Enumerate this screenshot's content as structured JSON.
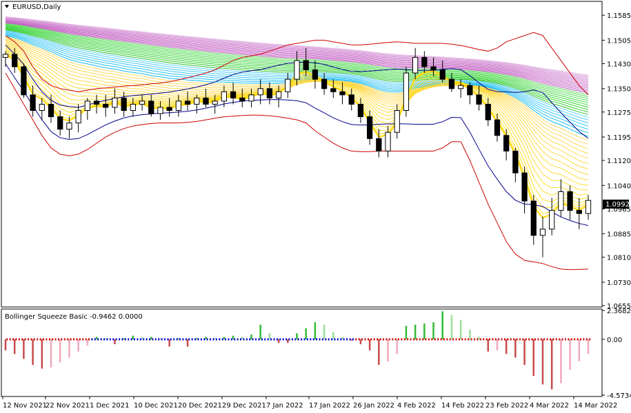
{
  "chart_data": [
    {
      "type": "candlestick",
      "title": "EURUSD,Daily",
      "yticks": [
        "1.1585",
        "1.1505",
        "1.1430",
        "1.1350",
        "1.1275",
        "1.1195",
        "1.1120",
        "1.1040",
        "1.0965",
        "1.0885",
        "1.0810",
        "1.0730",
        "1.0655"
      ],
      "ylim": [
        1.0655,
        1.1625
      ],
      "current_price": "1.0992",
      "colors": {
        "up": "#ffffff",
        "down": "#000000",
        "bb_outer": "#cc0000",
        "bb_inner": "#00008b",
        "ribbon_fast": "#ffd700",
        "ribbon_mid": "#00aaff",
        "ribbon_green": "#22cc22",
        "ribbon_slow": "#9944aa"
      },
      "candles": [
        [
          1.145,
          1.147,
          1.142,
          1.146
        ],
        [
          1.146,
          1.148,
          1.14,
          1.142
        ],
        [
          1.142,
          1.143,
          1.132,
          1.133
        ],
        [
          1.133,
          1.136,
          1.126,
          1.128
        ],
        [
          1.128,
          1.132,
          1.125,
          1.13
        ],
        [
          1.13,
          1.133,
          1.124,
          1.126
        ],
        [
          1.126,
          1.128,
          1.12,
          1.122
        ],
        [
          1.122,
          1.126,
          1.119,
          1.124
        ],
        [
          1.124,
          1.13,
          1.121,
          1.128
        ],
        [
          1.128,
          1.132,
          1.125,
          1.131
        ],
        [
          1.131,
          1.133,
          1.127,
          1.13
        ],
        [
          1.13,
          1.133,
          1.126,
          1.129
        ],
        [
          1.129,
          1.135,
          1.127,
          1.132
        ],
        [
          1.132,
          1.134,
          1.126,
          1.128
        ],
        [
          1.128,
          1.132,
          1.126,
          1.13
        ],
        [
          1.13,
          1.133,
          1.128,
          1.131
        ],
        [
          1.131,
          1.133,
          1.126,
          1.127
        ],
        [
          1.127,
          1.131,
          1.125,
          1.129
        ],
        [
          1.129,
          1.132,
          1.126,
          1.128
        ],
        [
          1.128,
          1.133,
          1.126,
          1.131
        ],
        [
          1.131,
          1.134,
          1.128,
          1.13
        ],
        [
          1.13,
          1.133,
          1.127,
          1.132
        ],
        [
          1.132,
          1.135,
          1.129,
          1.13
        ],
        [
          1.13,
          1.133,
          1.127,
          1.131
        ],
        [
          1.131,
          1.136,
          1.129,
          1.134
        ],
        [
          1.134,
          1.137,
          1.13,
          1.132
        ],
        [
          1.132,
          1.135,
          1.129,
          1.131
        ],
        [
          1.131,
          1.135,
          1.129,
          1.133
        ],
        [
          1.133,
          1.138,
          1.13,
          1.135
        ],
        [
          1.135,
          1.137,
          1.13,
          1.132
        ],
        [
          1.132,
          1.136,
          1.129,
          1.134
        ],
        [
          1.134,
          1.14,
          1.132,
          1.138
        ],
        [
          1.138,
          1.147,
          1.136,
          1.144
        ],
        [
          1.144,
          1.148,
          1.139,
          1.141
        ],
        [
          1.141,
          1.144,
          1.135,
          1.138
        ],
        [
          1.138,
          1.14,
          1.133,
          1.135
        ],
        [
          1.135,
          1.138,
          1.132,
          1.134
        ],
        [
          1.134,
          1.137,
          1.13,
          1.133
        ],
        [
          1.133,
          1.135,
          1.128,
          1.13
        ],
        [
          1.13,
          1.132,
          1.124,
          1.126
        ],
        [
          1.126,
          1.128,
          1.117,
          1.119
        ],
        [
          1.119,
          1.122,
          1.113,
          1.115
        ],
        [
          1.115,
          1.123,
          1.113,
          1.121
        ],
        [
          1.121,
          1.13,
          1.119,
          1.128
        ],
        [
          1.128,
          1.142,
          1.126,
          1.14
        ],
        [
          1.14,
          1.148,
          1.138,
          1.145
        ],
        [
          1.145,
          1.147,
          1.14,
          1.142
        ],
        [
          1.142,
          1.145,
          1.139,
          1.141
        ],
        [
          1.141,
          1.144,
          1.137,
          1.138
        ],
        [
          1.138,
          1.14,
          1.134,
          1.135
        ],
        [
          1.135,
          1.138,
          1.132,
          1.136
        ],
        [
          1.136,
          1.137,
          1.13,
          1.133
        ],
        [
          1.133,
          1.136,
          1.128,
          1.13
        ],
        [
          1.13,
          1.132,
          1.123,
          1.125
        ],
        [
          1.125,
          1.127,
          1.118,
          1.12
        ],
        [
          1.12,
          1.122,
          1.112,
          1.115
        ],
        [
          1.115,
          1.116,
          1.105,
          1.108
        ],
        [
          1.108,
          1.11,
          1.095,
          1.099
        ],
        [
          1.099,
          1.101,
          1.085,
          1.088
        ],
        [
          1.088,
          1.094,
          1.081,
          1.09
        ],
        [
          1.09,
          1.1,
          1.088,
          1.096
        ],
        [
          1.096,
          1.106,
          1.094,
          1.102
        ],
        [
          1.102,
          1.104,
          1.093,
          1.096
        ],
        [
          1.096,
          1.1,
          1.09,
          1.095
        ],
        [
          1.095,
          1.101,
          1.093,
          1.0992
        ]
      ],
      "bb_upper": [
        1.152,
        1.15,
        1.147,
        1.142,
        1.138,
        1.136,
        1.135,
        1.1345,
        1.134,
        1.1345,
        1.135,
        1.1352,
        1.1355,
        1.1358,
        1.136,
        1.1362,
        1.1365,
        1.1368,
        1.1372,
        1.1378,
        1.1385,
        1.1392,
        1.14,
        1.141,
        1.1425,
        1.144,
        1.145,
        1.1455,
        1.146,
        1.147,
        1.148,
        1.149,
        1.1495,
        1.15,
        1.1505,
        1.1505,
        1.15,
        1.1495,
        1.149,
        1.149,
        1.1492,
        1.1495,
        1.1498,
        1.15,
        1.1498,
        1.1495,
        1.1495,
        1.1495,
        1.1495,
        1.1492,
        1.1488,
        1.1482,
        1.1475,
        1.147,
        1.148,
        1.15,
        1.151,
        1.152,
        1.153,
        1.152,
        1.148,
        1.144,
        1.14,
        1.136,
        1.133
      ],
      "bb_lower": [
        1.14,
        1.135,
        1.13,
        1.125,
        1.12,
        1.116,
        1.114,
        1.1135,
        1.114,
        1.1155,
        1.1175,
        1.1195,
        1.121,
        1.1222,
        1.123,
        1.1235,
        1.1238,
        1.124,
        1.124,
        1.124,
        1.1242,
        1.1245,
        1.125,
        1.1255,
        1.126,
        1.1262,
        1.1264,
        1.1265,
        1.1265,
        1.1263,
        1.126,
        1.1255,
        1.125,
        1.124,
        1.1215,
        1.1195,
        1.1175,
        1.116,
        1.115,
        1.1148,
        1.1148,
        1.115,
        1.115,
        1.115,
        1.115,
        1.115,
        1.115,
        1.115,
        1.116,
        1.118,
        1.118,
        1.112,
        1.105,
        1.098,
        1.092,
        1.086,
        1.082,
        1.08,
        1.0795,
        1.079,
        1.078,
        1.0772,
        1.077,
        1.0771,
        1.0772
      ],
      "bb_mid": [
        1.146,
        1.142,
        1.1385,
        1.134,
        1.13,
        1.1265,
        1.1245,
        1.124,
        1.124,
        1.125,
        1.1262,
        1.1273,
        1.1282,
        1.129,
        1.1295,
        1.1298,
        1.13,
        1.1303,
        1.1306,
        1.131,
        1.1313,
        1.1318,
        1.1325,
        1.1332,
        1.1342,
        1.135,
        1.1356,
        1.136,
        1.1362,
        1.1366,
        1.137,
        1.1372,
        1.1372,
        1.137,
        1.136,
        1.135,
        1.1338,
        1.1328,
        1.132,
        1.1319,
        1.132,
        1.1322,
        1.1324,
        1.1325,
        1.1324,
        1.1322,
        1.1322,
        1.1322,
        1.1328,
        1.1336,
        1.1334,
        1.1301,
        1.1262,
        1.1225,
        1.12,
        1.118,
        1.1165,
        1.116,
        1.1162,
        1.1155,
        1.113,
        1.1106,
        1.1085,
        1.1065,
        1.1051
      ],
      "squeeze": {
        "label": "Bollinger Squeeze Basic -0.9462 0.0000",
        "yticks": [
          "2.3682",
          "0.00",
          "-4.5734"
        ],
        "ylim": [
          -4.5734,
          2.3682
        ],
        "values": [
          -0.9,
          -1.2,
          -1.6,
          -2.1,
          -2.4,
          -2.3,
          -1.9,
          -1.5,
          -1.0,
          -0.5,
          0.2,
          0.1,
          -0.4,
          0.1,
          0.3,
          0.2,
          0.2,
          0.1,
          -0.6,
          0.1,
          -0.6,
          0.1,
          0.2,
          0.1,
          0.2,
          0.3,
          0.2,
          0.4,
          1.2,
          0.5,
          -0.3,
          -0.3,
          0.5,
          0.9,
          1.4,
          1.2,
          0.6,
          0.2,
          -0.1,
          -0.4,
          -0.9,
          -2.1,
          -1.8,
          -1.2,
          1.1,
          1.2,
          1.3,
          1.4,
          2.3,
          2.0,
          1.6,
          0.8,
          0.2,
          -1.0,
          -0.9,
          -1.2,
          -1.5,
          -2.1,
          -3.0,
          -3.7,
          -4.1,
          -3.6,
          -2.5,
          -1.8,
          -1.2
        ],
        "squeeze_on_range": [
          10,
          38
        ]
      },
      "xlabels": [
        "12 Nov 2021",
        "22 Nov 2021",
        "1 Dec 2021",
        "10 Dec 2021",
        "20 Dec 2021",
        "29 Dec 2021",
        "7 Jan 2022",
        "17 Jan 2022",
        "26 Jan 2022",
        "4 Feb 2022",
        "14 Feb 2022",
        "23 Feb 2022",
        "4 Mar 2022",
        "14 Mar 2022"
      ]
    }
  ]
}
